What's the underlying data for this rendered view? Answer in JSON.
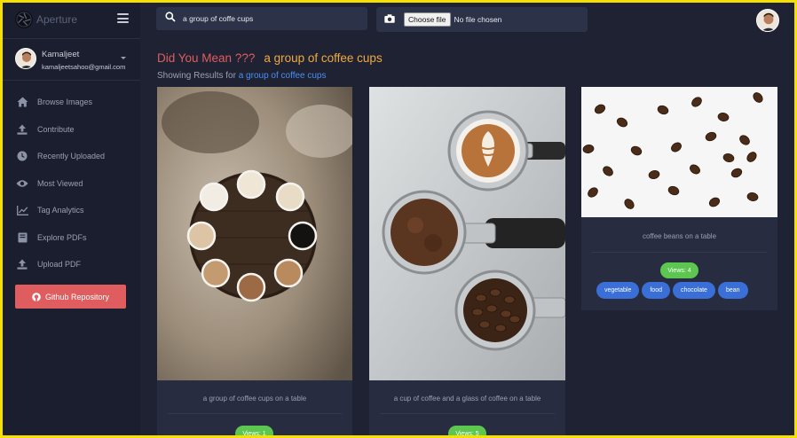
{
  "app": {
    "name": "Aperture"
  },
  "user": {
    "name": "Kamaljeet",
    "email": "kamaljeetsahoo@gmail.com"
  },
  "sidebar": {
    "items": [
      {
        "label": "Browse Images",
        "icon": "home-icon"
      },
      {
        "label": "Contribute",
        "icon": "upload-icon"
      },
      {
        "label": "Recently Uploaded",
        "icon": "clock-icon"
      },
      {
        "label": "Most Viewed",
        "icon": "eye-icon"
      },
      {
        "label": "Tag Analytics",
        "icon": "chart-icon"
      },
      {
        "label": "Explore PDFs",
        "icon": "book-icon"
      },
      {
        "label": "Upload PDF",
        "icon": "upload-icon"
      }
    ],
    "github_label": "Github Repository"
  },
  "search": {
    "value": "a group of coffe cups"
  },
  "upload": {
    "button_label": "Choose file",
    "status": "No file chosen"
  },
  "results": {
    "did_you_mean_label": "Did You Mean ???",
    "suggestion": "a group of coffee cups",
    "showing_prefix": "Showing Results for",
    "showing_query": "a group of coffee cups"
  },
  "cards": [
    {
      "caption": "a group of coffee cups on a table",
      "views": "Views: 1"
    },
    {
      "caption": "a cup of coffee and a glass of coffee on a table",
      "views": "Views: 5"
    },
    {
      "caption": "coffee beans on a table",
      "views": "Views: 4",
      "tags": [
        "vegetable",
        "food",
        "chocolate",
        "bean"
      ]
    }
  ],
  "colors": {
    "accent_red": "#e05d5f",
    "accent_orange": "#f0a940",
    "link_blue": "#4c8ef0",
    "views_green": "#5cc651",
    "tag_blue": "#3a6fd8"
  }
}
